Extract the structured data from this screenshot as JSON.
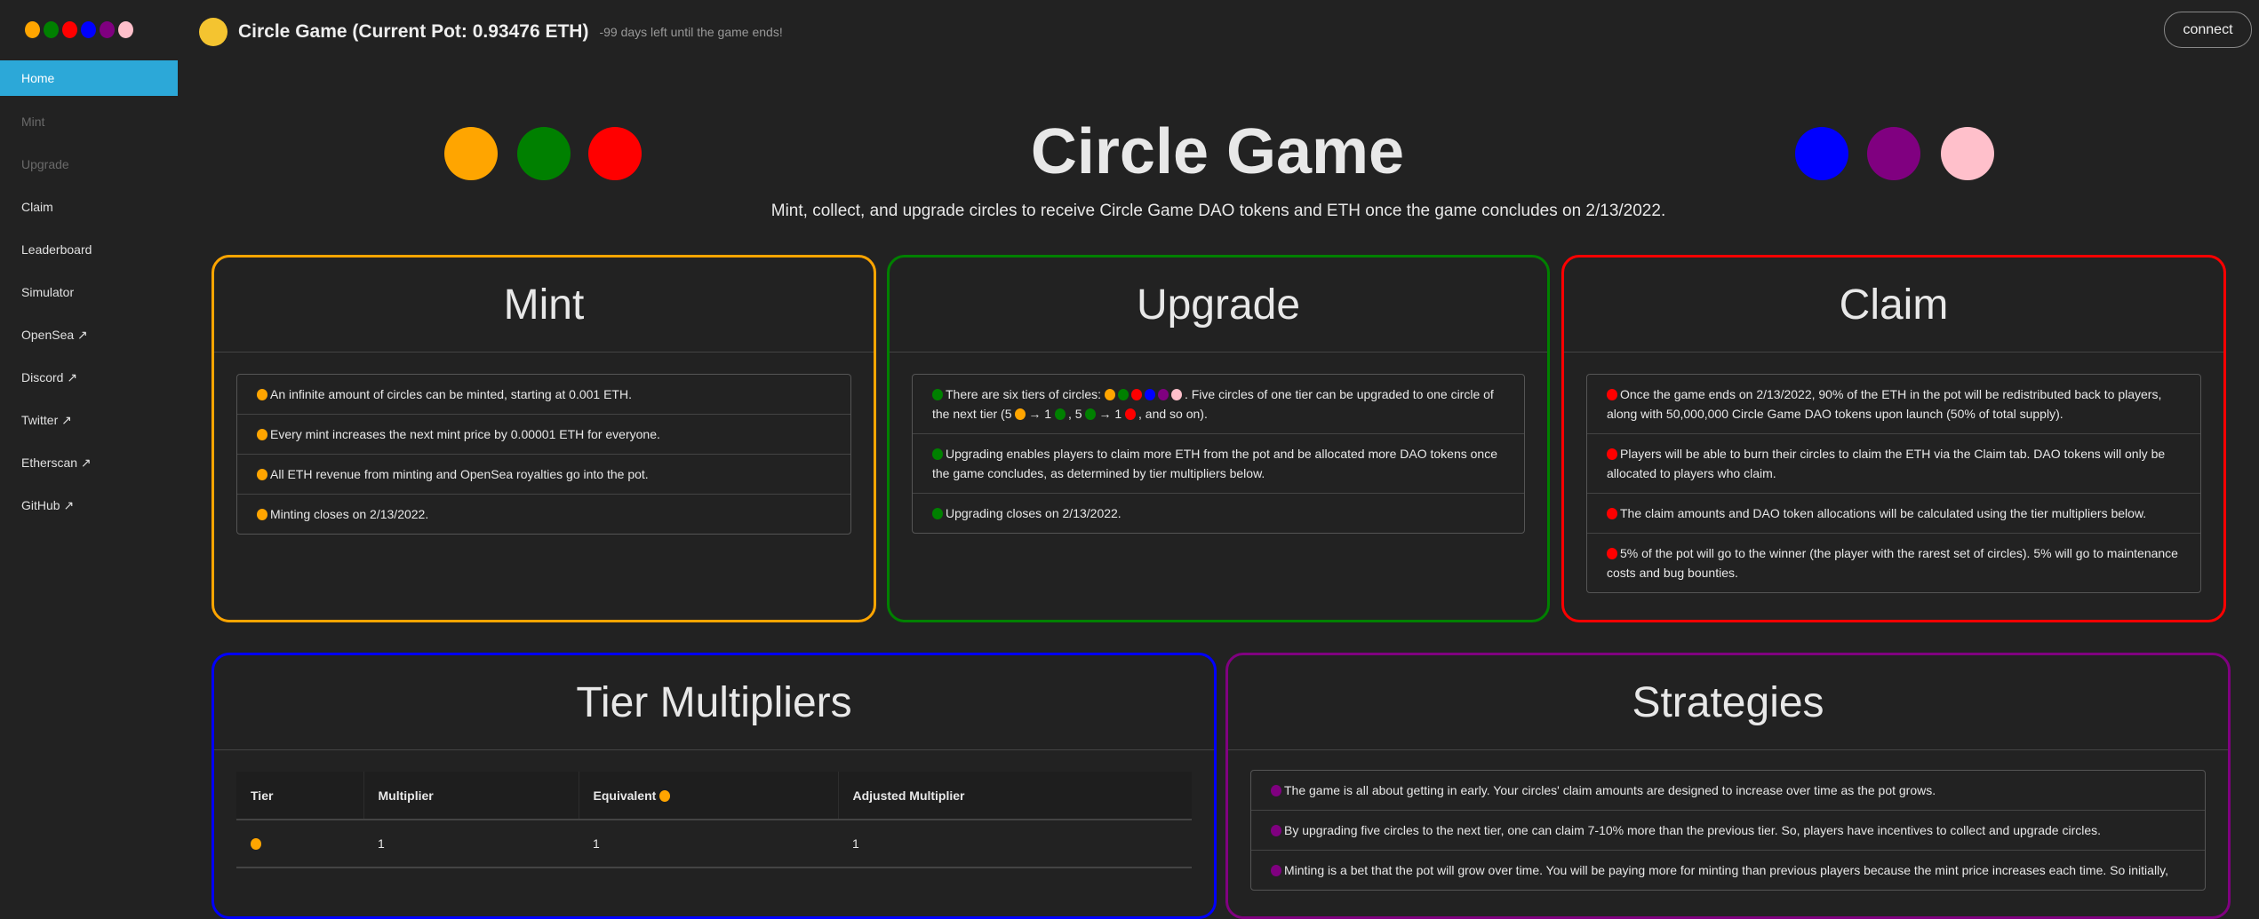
{
  "sidebar": {
    "items": [
      {
        "label": "Home"
      },
      {
        "label": "Mint"
      },
      {
        "label": "Upgrade"
      },
      {
        "label": "Claim"
      },
      {
        "label": "Leaderboard"
      },
      {
        "label": "Simulator"
      },
      {
        "label": "OpenSea ↗"
      },
      {
        "label": "Discord ↗"
      },
      {
        "label": "Twitter ↗"
      },
      {
        "label": "Etherscan ↗"
      },
      {
        "label": "GitHub ↗"
      }
    ]
  },
  "header": {
    "title": "Circle Game (Current Pot: 0.93476 ETH)",
    "days_left": "-99 days left until the game ends!",
    "connect_label": "connect"
  },
  "hero": {
    "title": "Circle Game",
    "subtitle": "Mint, collect, and upgrade circles to receive Circle Game DAO tokens and ETH once the game concludes on 2/13/2022."
  },
  "colors": {
    "orange": "#ffa500",
    "green": "#008000",
    "red": "#ff0000",
    "blue": "#0000ff",
    "purple": "#800080",
    "pink": "#ffc0cb",
    "accent": "#2ca8d8"
  },
  "mint": {
    "title": "Mint",
    "items": [
      "An infinite amount of circles can be minted, starting at 0.001 ETH.",
      "Every mint increases the next mint price by 0.00001 ETH for everyone.",
      "All ETH revenue from minting and OpenSea royalties go into the pot.",
      "Minting closes on 2/13/2022."
    ]
  },
  "upgrade": {
    "title": "Upgrade",
    "item1": {
      "a": "There are six tiers of circles:",
      "b": ". Five circles of one tier can be upgraded to one circle of the next tier (5",
      "c": "→ 1",
      "d": ", 5",
      "e": "→ 1",
      "f": ", and so on)."
    },
    "items": [
      "Upgrading enables players to claim more ETH from the pot and be allocated more DAO tokens once the game concludes, as determined by tier multipliers below.",
      "Upgrading closes on 2/13/2022."
    ]
  },
  "claim": {
    "title": "Claim",
    "items": [
      "Once the game ends on 2/13/2022, 90% of the ETH in the pot will be redistributed back to players, along with 50,000,000 Circle Game DAO tokens upon launch (50% of total supply).",
      "Players will be able to burn their circles to claim the ETH via the Claim tab. DAO tokens will only be allocated to players who claim.",
      "The claim amounts and DAO token allocations will be calculated using the tier multipliers below.",
      "5% of the pot will go to the winner (the player with the rarest set of circles). 5% will go to maintenance costs and bug bounties."
    ]
  },
  "tiers": {
    "title": "Tier Multipliers",
    "columns": [
      "Tier",
      "Multiplier",
      "Equivalent",
      "Adjusted Multiplier"
    ],
    "rows": [
      {
        "multiplier": "1",
        "equivalent": "1",
        "adjusted": "1"
      }
    ]
  },
  "strategies": {
    "title": "Strategies",
    "items": [
      "The game is all about getting in early. Your circles' claim amounts are designed to increase over time as the pot grows.",
      "By upgrading five circles to the next tier, one can claim 7-10% more than the previous tier. So, players have incentives to collect and upgrade circles.",
      "Minting is a bet that the pot will grow over time. You will be paying more for minting than previous players because the mint price increases each time. So initially,"
    ]
  }
}
